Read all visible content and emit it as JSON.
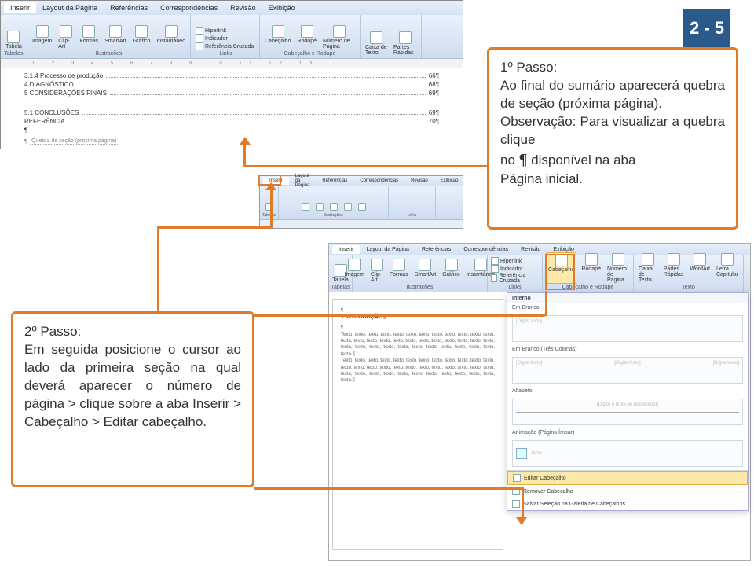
{
  "page_badge": "2 - 5",
  "callout1": {
    "title": "1º Passo:",
    "body_before_obs": "Ao final do sumário aparecerá quebra de seção (próxima página).",
    "obs_label": "Observação",
    "obs_rest": ": Para visualizar a quebra clique",
    "line3_pre": "no ",
    "line3_post": " disponível na aba",
    "line4": "Página inicial."
  },
  "callout2": {
    "title": "2º Passo:",
    "body": "Em seguida posicione o cursor ao lado da primeira seção na qual deverá aparecer o número de página > clique sobre a aba Inserir > Cabeçalho > Editar cabeçalho."
  },
  "tabs_top": [
    "Inserir",
    "Layout da Página",
    "Referências",
    "Correspondências",
    "Revisão",
    "Exibição"
  ],
  "ribbon_top": {
    "group1": {
      "label": "Tabelas",
      "btn": "Tabela"
    },
    "group2": {
      "label": "Ilustrações",
      "btns": [
        "Imagem",
        "Clip-Art",
        "Formas",
        "SmartArt",
        "Gráfico",
        "Instantâneo"
      ]
    },
    "group3": {
      "label": "Links",
      "rows": [
        "Hiperlink",
        "Indicador",
        "Referência Cruzada"
      ]
    },
    "group4": {
      "label": "Cabeçalho e Rodapé",
      "btns": [
        "Cabeçalho",
        "Rodapé",
        "Número de Página"
      ]
    },
    "group5": {
      "btns": [
        "Caixa de Texto",
        "Partes Rápidas"
      ]
    }
  },
  "ruler_marks": "1 2 3 4 5 6 7 8 9 10 11 12 13",
  "doc_top_lines": [
    {
      "left": "3.1.4 Processo de produção",
      "right": "66¶"
    },
    {
      "left": "4 DIAGNÓSTICO",
      "right": "68¶"
    },
    {
      "left": "5 CONSIDERAÇÕES FINAIS",
      "right": "69¶"
    }
  ],
  "doc_top_lines2": [
    {
      "left": "5.1 CONCLUSÕES",
      "right": "69¶"
    },
    {
      "left": "REFERÊNCIA",
      "right": "70¶"
    }
  ],
  "section_break": "Quebra de seção (próxima página)",
  "tabs_bottom": [
    "Inserir",
    "Layout da Página",
    "Referências",
    "Correspondências",
    "Revisão",
    "Exibição"
  ],
  "ribbon_bottom": {
    "group1": {
      "label": "Tabelas",
      "btn": "Tabela"
    },
    "group2": {
      "label": "Ilustrações",
      "btns": [
        "Imagem",
        "Clip-Art",
        "Formas",
        "SmartArt",
        "Gráfico",
        "Instantâneo"
      ]
    },
    "group3": {
      "label": "Links",
      "rows": [
        "Hiperlink",
        "Indicador",
        "Referência Cruzada"
      ]
    },
    "group4": {
      "label": "Cabeçalho e Rodapé",
      "btns": [
        "Cabeçalho",
        "Rodapé",
        "Número de Página"
      ]
    },
    "group5": {
      "label": "Texto",
      "btns": [
        "Caixa de Texto",
        "Partes Rápidas",
        "WordArt",
        "Letra Capitular"
      ]
    }
  },
  "gallery": {
    "interno": "Interno",
    "brancos": "Em Branco",
    "brancos3": "Em Branco (Três Colunas)",
    "ph_text": "[Digite texto]",
    "alfabeto": "Alfabeto",
    "alfabeto_ph": "[Digite o título do documento]",
    "anim": "Animação (Página Ímpar)",
    "anim_note": "Nota",
    "menu1": "Editar Cabeçalho",
    "menu2": "Remover Cabeçalho",
    "menu3": "Salvar Seleção na Galeria de Cabeçalhos..."
  },
  "doc_bottom": {
    "title": "1 INTRODUÇÃO¶",
    "filler": "Texto, texto, texto, texto, texto, texto, texto, texto, texto, texto, texto, texto, texto, texto, texto, texto, texto, texto, texto, texto, texto, texto, texto, texto, texto, texto, texto, texto, texto, texto, texto, texto, texto, texto, texto, texto.¶"
  },
  "mini": {
    "tabs": [
      "Inserir",
      "Layout da Página",
      "Referências",
      "Correspondências",
      "Revisão",
      "Exibição"
    ]
  }
}
